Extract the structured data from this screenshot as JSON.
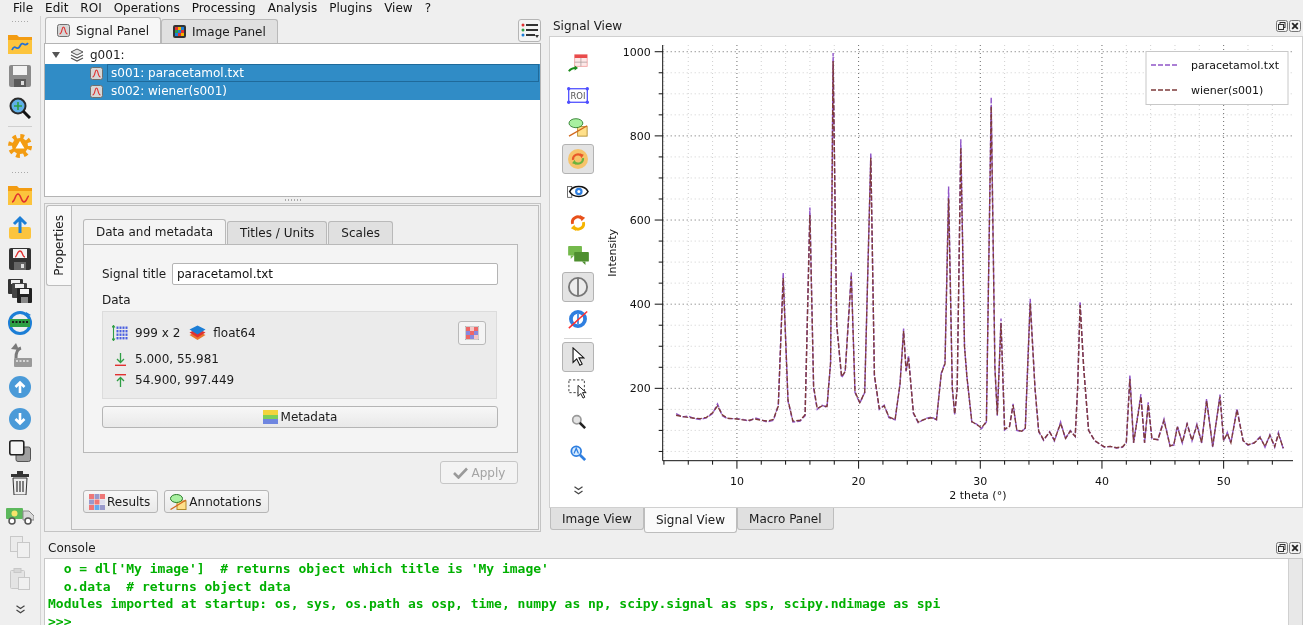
{
  "menu": [
    "File",
    "Edit",
    "ROI",
    "Operations",
    "Processing",
    "Analysis",
    "Plugins",
    "View",
    "?"
  ],
  "left_toolbars": [
    {
      "groups": [
        [
          {
            "kind": "hdfopen",
            "disabled": false
          },
          {
            "kind": "hdfsave",
            "disabled": false
          },
          {
            "kind": "hdfbrowse",
            "disabled": false
          }
        ],
        [
          {
            "kind": "gear",
            "disabled": false
          }
        ]
      ]
    },
    {
      "groups": [
        [
          {
            "kind": "signalopen",
            "disabled": false
          },
          {
            "kind": "export",
            "disabled": false
          },
          {
            "kind": "signalsave",
            "disabled": false
          },
          {
            "kind": "saveall",
            "disabled": false
          },
          {
            "kind": "memory",
            "disabled": false
          },
          {
            "kind": "undo",
            "disabled": false
          },
          {
            "kind": "up",
            "disabled": false
          },
          {
            "kind": "down",
            "disabled": false
          },
          {
            "kind": "duplicate",
            "disabled": false
          },
          {
            "kind": "trash",
            "disabled": false
          },
          {
            "kind": "truck",
            "disabled": false
          },
          {
            "kind": "copy",
            "disabled": true
          },
          {
            "kind": "paste",
            "disabled": true
          }
        ]
      ],
      "overflow": true
    }
  ],
  "panel_tabs": [
    {
      "kind": "signal",
      "label": "Signal Panel",
      "selected": true
    },
    {
      "kind": "image",
      "label": "Image Panel",
      "selected": false
    }
  ],
  "tree": {
    "label": "g001:",
    "expanded": true,
    "children": [
      {
        "label": "s001: paracetamol.txt",
        "selected": true,
        "focused": true
      },
      {
        "label": "s002: wiener(s001)",
        "selected": true,
        "focused": false
      }
    ]
  },
  "properties": {
    "side_tabs": [
      {
        "label": "Properties",
        "selected": true
      }
    ],
    "tabs": [
      {
        "label": "Data and metadata",
        "selected": true
      },
      {
        "label": "Titles / Units",
        "selected": false
      },
      {
        "label": "Scales",
        "selected": false
      }
    ],
    "title_field": {
      "label": "Signal title",
      "value": "paracetamol.txt"
    },
    "data": {
      "label": "Data",
      "shape": "999 x 2",
      "dtype": "float64",
      "min": "5.000, 55.981",
      "max": "54.900, 997.449"
    },
    "metadata_button": "Metadata",
    "apply": {
      "label": "Apply",
      "disabled": true
    },
    "buttons": [
      {
        "kind": "results",
        "label": "Results"
      },
      {
        "kind": "annotations",
        "label": "Annotations"
      }
    ]
  },
  "signal_view": {
    "title": "Signal View",
    "toolbar": {
      "groups": [
        [
          {
            "kind": "table",
            "active": false
          },
          {
            "kind": "roi",
            "active": false,
            "text": "ROI"
          },
          {
            "kind": "annotation",
            "active": false
          },
          {
            "kind": "refresh",
            "active": true
          },
          {
            "kind": "eye",
            "active": false
          },
          {
            "kind": "sync",
            "active": false
          },
          {
            "kind": "comments",
            "active": false
          },
          {
            "kind": "crosshair",
            "active": true
          },
          {
            "kind": "nocurve",
            "active": false
          }
        ],
        [
          {
            "kind": "pointer",
            "active": true
          },
          {
            "kind": "selectrect",
            "active": false
          },
          {
            "kind": "zoom",
            "active": false
          },
          {
            "kind": "autoscale",
            "active": false
          }
        ]
      ],
      "overflow": true
    },
    "chart_data": {
      "type": "line",
      "xlabel": "2 theta (°)",
      "ylabel": "Intensity",
      "grid": true,
      "legend": "upper right",
      "x": [
        5.0,
        5.5,
        6.0,
        6.5,
        7.0,
        7.5,
        8.0,
        8.4,
        8.8,
        9.2,
        10.0,
        10.5,
        11.0,
        11.5,
        12.0,
        12.5,
        13.0,
        13.4,
        13.8,
        14.2,
        14.6,
        15.2,
        15.6,
        16.0,
        16.3,
        16.6,
        17.0,
        17.4,
        17.7,
        17.9,
        18.2,
        18.6,
        18.9,
        19.4,
        19.7,
        20.1,
        20.5,
        21.0,
        21.3,
        21.7,
        22.1,
        22.5,
        23.0,
        23.4,
        23.7,
        23.9,
        24.1,
        24.5,
        24.9,
        25.5,
        26.0,
        26.4,
        26.8,
        27.1,
        27.4,
        27.7,
        27.9,
        28.1,
        28.4,
        28.7,
        28.9,
        29.3,
        29.7,
        30.1,
        30.5,
        30.9,
        31.2,
        31.4,
        31.7,
        32.0,
        32.4,
        32.7,
        33.0,
        33.4,
        33.7,
        34.1,
        34.5,
        34.8,
        35.2,
        35.7,
        36.1,
        36.6,
        37.0,
        37.4,
        37.8,
        38.0,
        38.2,
        38.5,
        38.9,
        39.4,
        39.8,
        40.2,
        40.7,
        41.2,
        41.7,
        42.0,
        42.3,
        42.6,
        43.2,
        43.5,
        43.8,
        44.1,
        44.6,
        45.1,
        45.6,
        45.9,
        46.2,
        46.6,
        47.0,
        47.4,
        47.8,
        48.2,
        48.6,
        49.1,
        49.7,
        50.0,
        50.3,
        50.6,
        51.1,
        51.6,
        52.0,
        52.5,
        53.0,
        53.4,
        53.8,
        54.2,
        54.5,
        54.9
      ],
      "series": [
        {
          "name": "paracetamol.txt",
          "color": "#9055c8",
          "line_style": "dashed",
          "values": [
            140,
            132,
            134,
            128,
            126,
            130,
            140,
            163,
            135,
            128,
            128,
            126,
            122,
            130,
            125,
            120,
            124,
            160,
            475,
            170,
            120,
            122,
            135,
            630,
            200,
            150,
            160,
            155,
            260,
            997,
            350,
            225,
            240,
            475,
            190,
            165,
            190,
            760,
            230,
            150,
            160,
            130,
            125,
            210,
            342,
            240,
            278,
            140,
            118,
            128,
            132,
            125,
            237,
            260,
            680,
            200,
            137,
            200,
            792,
            300,
            228,
            120,
            115,
            104,
            120,
            892,
            250,
            135,
            366,
            101,
            110,
            163,
            100,
            97,
            105,
            413,
            200,
            97,
            76,
            97,
            75,
            120,
            80,
            100,
            85,
            200,
            406,
            250,
            100,
            75,
            68,
            60,
            62,
            58,
            60,
            70,
            232,
            70,
            186,
            70,
            167,
            80,
            78,
            127,
            62,
            65,
            110,
            70,
            118,
            75,
            115,
            70,
            175,
            60,
            185,
            75,
            95,
            70,
            152,
            75,
            65,
            70,
            85,
            60,
            90,
            60,
            95,
            56
          ]
        },
        {
          "name": "wiener(s001)",
          "color": "#7e3b3b",
          "line_style": "dashed",
          "values": [
            136,
            133,
            131,
            129,
            128,
            131,
            142,
            158,
            137,
            129,
            127,
            125,
            124,
            127,
            124,
            122,
            126,
            158,
            462,
            172,
            122,
            124,
            137,
            612,
            205,
            152,
            158,
            157,
            262,
            978,
            352,
            228,
            240,
            466,
            192,
            166,
            190,
            748,
            232,
            152,
            158,
            132,
            126,
            210,
            336,
            242,
            272,
            142,
            120,
            127,
            130,
            126,
            235,
            258,
            652,
            202,
            139,
            200,
            772,
            300,
            228,
            121,
            114,
            106,
            121,
            870,
            250,
            137,
            355,
            103,
            109,
            160,
            101,
            98,
            106,
            402,
            200,
            98,
            78,
            96,
            77,
            117,
            81,
            98,
            86,
            198,
            398,
            248,
            100,
            76,
            68,
            61,
            62,
            59,
            61,
            71,
            222,
            71,
            180,
            71,
            162,
            80,
            78,
            123,
            63,
            66,
            108,
            71,
            115,
            76,
            112,
            71,
            170,
            62,
            180,
            76,
            93,
            71,
            148,
            76,
            66,
            70,
            83,
            62,
            88,
            62,
            91,
            58
          ]
        }
      ],
      "xlim": [
        3.9,
        55.7
      ],
      "ylim": [
        28,
        1016
      ],
      "xticks": [
        10,
        20,
        30,
        40,
        50
      ],
      "yticks": [
        200,
        400,
        600,
        800,
        1000
      ]
    },
    "tabs": [
      {
        "label": "Image View",
        "selected": false
      },
      {
        "label": "Signal View",
        "selected": true
      },
      {
        "label": "Macro Panel",
        "selected": false
      }
    ]
  },
  "console": {
    "title": "Console",
    "lines": [
      "  o = dl['My image']  # returns object which title is 'My image'",
      "  o.data  # returns object data",
      "Modules imported at startup: os, sys, os.path as osp, time, numpy as np, scipy.signal as sps, scipy.ndimage as spi"
    ],
    "prompt": ">>>"
  }
}
